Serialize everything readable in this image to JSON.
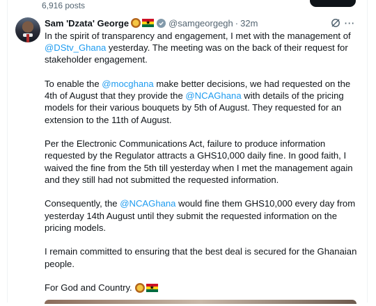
{
  "post_count": "6,916 posts",
  "author": {
    "name": "Sam 'Dzata' George",
    "handle": "@samgeorgegh",
    "time": "32m",
    "name_emojis": [
      "lion-emoji",
      "ghana-flag-emoji"
    ]
  },
  "tweet": {
    "p1": {
      "t1": "In the spirit of transparency and engagement, I met with the management of ",
      "m1": "@DStv_Ghana",
      "t2": " yesterday. The meeting was on the back of their request for stakeholder engagement."
    },
    "p2": {
      "t1": "To enable the ",
      "m1": "@mocghana",
      "t2": " make better decisions, we had requested on the 4th of August that they provide the ",
      "m2": "@NCAGhana",
      "t3": " with details of the pricing models for their various bouquets by 5th of August. They requested for an extension to the 11th of August."
    },
    "p3": "Per the Electronic Communications Act, failure to produce information requested by the Regulator attracts a GHS10,000 daily fine. In good faith, I waived the fine from the 5th till yesterday when I met the management again and they still had not submitted the requested information.",
    "p4": {
      "t1": "Consequently, the ",
      "m1": "@NCAGhana",
      "t2": " would fine them GHS10,000 every day from yesterday 14th August until they submit the requested information on the pricing models."
    },
    "p5": "I remain committed to ensuring that the best deal is secured for the Ghanaian people.",
    "p6": "For God and Country."
  },
  "colors": {
    "mention": "#1d9bf0",
    "muted": "#536471",
    "text": "#0f1419"
  }
}
